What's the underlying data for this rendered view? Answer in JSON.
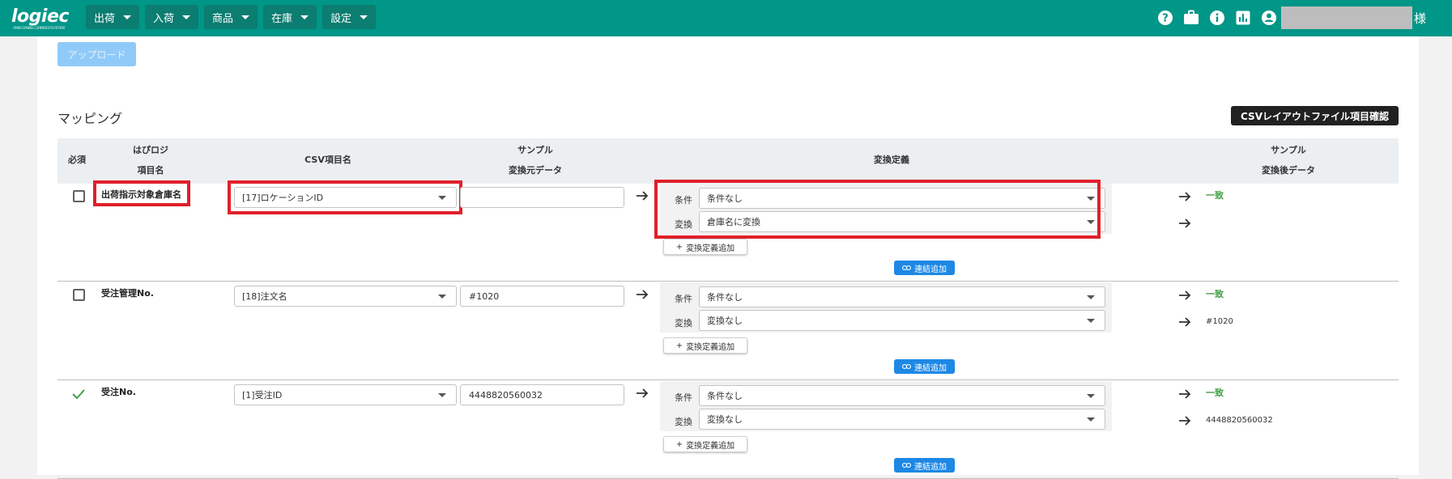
{
  "app": {
    "logo": "logiec",
    "logo_sub": "OMNI-CHANNEL COMMERCE PLATFORM",
    "nav": [
      "出荷",
      "入荷",
      "商品",
      "在庫",
      "設定"
    ],
    "header_icons": [
      "help-icon",
      "briefcase-icon",
      "info-icon",
      "chart-icon",
      "account-icon"
    ],
    "user_suffix": "様"
  },
  "page": {
    "upload_label": "アップロード",
    "section_title": "マッピング",
    "csv_layout_button": "CSVレイアウトファイル項目確認"
  },
  "table": {
    "headers": {
      "required": "必須",
      "item_name_1": "はぴロジ",
      "item_name_2": "項目名",
      "csv_item": "CSV項目名",
      "sample_src_1": "サンプル",
      "sample_src_2": "変換元データ",
      "conversion": "変換定義",
      "sample_dst_1": "サンプル",
      "sample_dst_2": "変換後データ"
    },
    "labels": {
      "condition": "条件",
      "convert": "変換",
      "add_definition": "変換定義追加",
      "add_connection": "連結追加"
    },
    "rows": [
      {
        "required": "unchecked",
        "item": "出荷指示対象倉庫名",
        "csv_field": "[17]ロケーションID",
        "sample_src": "",
        "condition": "条件なし",
        "convert": "倉庫名に変換",
        "match": "一致",
        "result": ""
      },
      {
        "required": "unchecked",
        "item": "受注管理No.",
        "csv_field": "[18]注文名",
        "sample_src": "#1020",
        "condition": "条件なし",
        "convert": "変換なし",
        "match": "一致",
        "result": "#1020"
      },
      {
        "required": "checkmark",
        "item": "受注No.",
        "csv_field": "[1]受注ID",
        "sample_src": "4448820560032",
        "condition": "条件なし",
        "convert": "変換なし",
        "match": "一致",
        "result": "4448820560032"
      }
    ]
  },
  "colors": {
    "header_bg": "#009688",
    "highlight": "#e0202a",
    "accent_blue": "#1e88e5",
    "match_green": "#43a047"
  }
}
